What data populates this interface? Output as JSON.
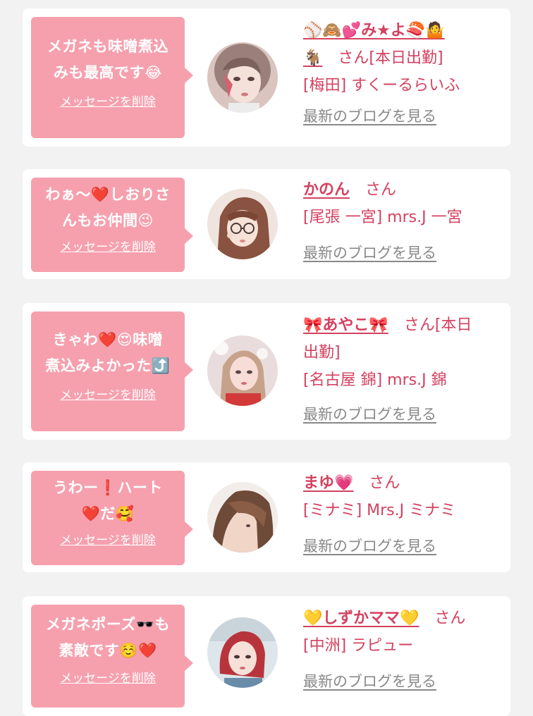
{
  "colors": {
    "page_bg": "#f2f2f2",
    "card_bg": "#ffffff",
    "bubble_pink": "#f6a0ae",
    "name_pink": "#d4415f",
    "link_gray": "#888888"
  },
  "cards": [
    {
      "message_line1": "メガネも味噌煮込",
      "message_line2": "みも最高です😂",
      "delete_label": "メッセージを削除",
      "name": "⚾🙈💕み★よ🍣🤷",
      "name_line2": "🐐",
      "suffix": "さん[本日出勤]",
      "shop": "[梅田] すくーるらいふ",
      "blog_label": "最新のブログを見る"
    },
    {
      "message_line1": "わぁ〜❤️しおりさ",
      "message_line2": "んもお仲間😉",
      "delete_label": "メッセージを削除",
      "name": "かのん",
      "suffix": "さん",
      "shop": "[尾張 一宮] mrs.J 一宮",
      "blog_label": "最新のブログを見る"
    },
    {
      "message_line1": "きゃわ❤️😍味噌",
      "message_line2": "煮込みよかった⤴️",
      "delete_label": "メッセージを削除",
      "name": "🎀あやこ🎀",
      "suffix": "さん[本日",
      "suffix_line2": "出勤]",
      "shop": "[名古屋 錦] mrs.J 錦",
      "blog_label": "最新のブログを見る"
    },
    {
      "message_line1": "うわー❗ハート",
      "message_line2": "❤️だ🥰",
      "delete_label": "メッセージを削除",
      "name": "まゆ💗",
      "suffix": "さん",
      "shop": "[ミナミ] Mrs.J ミナミ",
      "blog_label": "最新のブログを見る"
    },
    {
      "message_line1": "メガネポーズ🕶️も",
      "message_line2": "素敵です☺️❤️",
      "delete_label": "メッセージを削除",
      "name": "💛しずかママ💛",
      "suffix": "さん",
      "shop": "[中洲] ラピュー",
      "blog_label": "最新のブログを見る"
    }
  ]
}
